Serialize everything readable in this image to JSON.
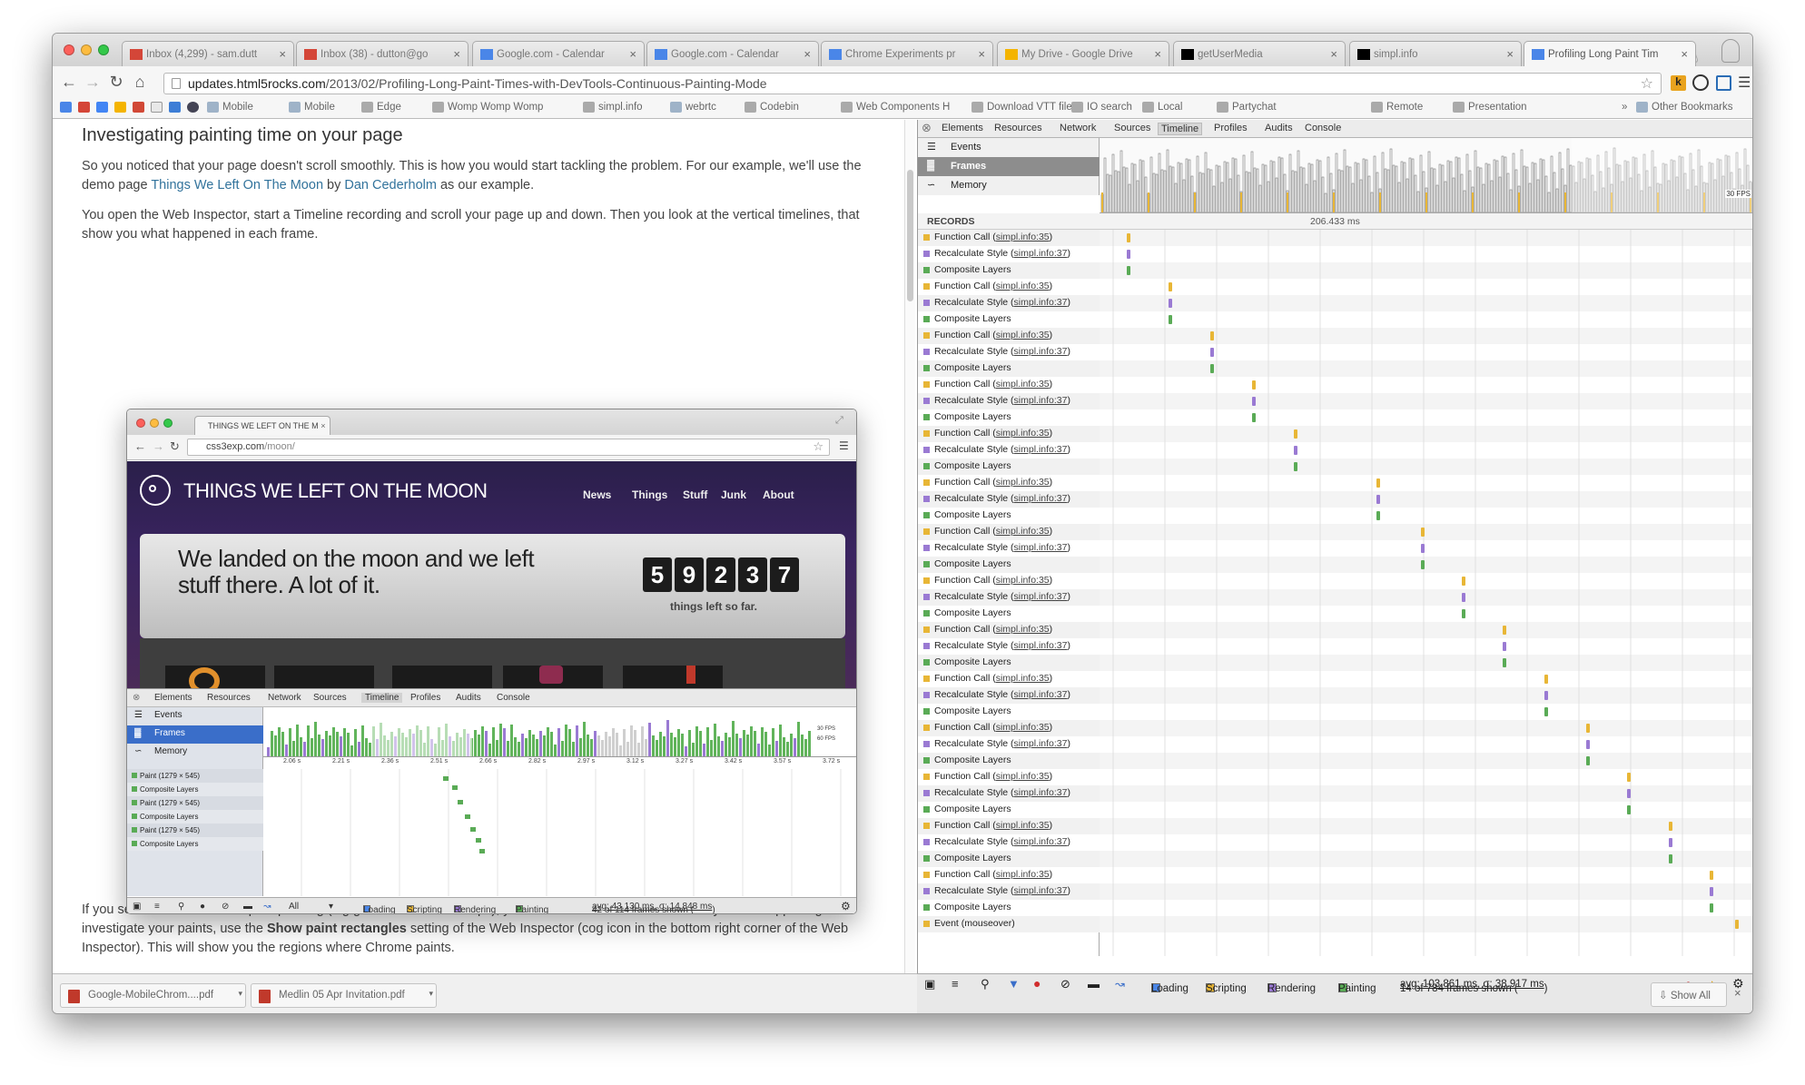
{
  "tabs": [
    {
      "label": "Inbox (4,299) - sam.dutt",
      "icon": "gmail-icon",
      "color": "#d44638"
    },
    {
      "label": "Inbox (38) - dutton@go",
      "icon": "gmail-icon",
      "color": "#d44638"
    },
    {
      "label": "Google.com - Calendar",
      "icon": "calendar-icon",
      "color": "#4a86e8"
    },
    {
      "label": "Google.com - Calendar",
      "icon": "calendar-icon",
      "color": "#4a86e8"
    },
    {
      "label": "Chrome Experiments pr",
      "icon": "page-icon",
      "color": "#4a86e8"
    },
    {
      "label": "My Drive - Google Drive",
      "icon": "drive-icon",
      "color": "#f4b400"
    },
    {
      "label": "getUserMedia",
      "icon": "simpl-icon",
      "color": "#000000"
    },
    {
      "label": "simpl.info",
      "icon": "simpl-icon",
      "color": "#000000"
    },
    {
      "label": "Profiling Long Paint Tim",
      "icon": "html5-icon",
      "color": "#4a86e8"
    }
  ],
  "omnibox": {
    "host": "updates.html5rocks.com",
    "path": "/2013/02/Profiling-Long-Paint-Times-with-DevTools-Continuous-Painting-Mode"
  },
  "bookmarks": [
    "Mobile",
    "Mobile",
    "Edge",
    "Womp Womp Womp",
    "simpl.info",
    "webrtc",
    "Codebin",
    "Web Components H",
    "Download VTT files",
    "IO search",
    "Local",
    "Partychat",
    "Remote",
    "Presentation",
    "Other Bookmarks"
  ],
  "article": {
    "heading": "Investigating painting time on your page",
    "p1_a": "So you noticed that your page doesn't scroll smoothly. This is how you would start tackling the problem. For our example, we'll use the demo page ",
    "p1_link1": "Things We Left On The Moon",
    "p1_b": " by ",
    "p1_link2": "Dan Cederholm",
    "p1_c": " as our example.",
    "p2": "You open the Web Inspector, start a Timeline recording and scroll your page up and down. Then you look at the vertical timelines, that show you what happened in each frame.",
    "p3_a": "If you see that most time is spent painting (big green bars above 60fps), you need to take a closer look at why this is happening. To investigate your paints, use the ",
    "p3_bold": "Show paint rectangles",
    "p3_b": " setting of the Web Inspector (cog icon in the bottom right corner of the Web Inspector). This will show you the regions where Chrome paints."
  },
  "screenshot": {
    "tab": "THINGS WE LEFT ON THE M",
    "url_host": "css3exp.com",
    "url_path": "/moon/",
    "site_title": "THINGS WE LEFT ON THE MOON",
    "nav": [
      "News",
      "Things",
      "Stuff",
      "Junk",
      "About"
    ],
    "hero": "We landed on the moon and we left stuff there. A lot of it.",
    "counter": [
      "5",
      "9",
      "2",
      "3",
      "7"
    ],
    "counter_caption": "things left so far.",
    "devtabs": [
      "Elements",
      "Resources",
      "Network",
      "Sources",
      "Timeline",
      "Profiles",
      "Audits",
      "Console"
    ],
    "side": [
      "Events",
      "Frames",
      "Memory"
    ],
    "times": [
      "2.06 s",
      "2.21 s",
      "2.36 s",
      "2.51 s",
      "2.66 s",
      "2.82 s",
      "2.97 s",
      "3.12 s",
      "3.27 s",
      "3.42 s",
      "3.57 s",
      "3.72 s"
    ],
    "records": [
      "Paint (1279 × 545)",
      "Composite Layers",
      "Paint (1279 × 545)",
      "Composite Layers",
      "Paint (1279 × 545)",
      "Composite Layers"
    ],
    "fps30": "30 FPS",
    "fps60": "60 FPS",
    "filter": "All",
    "checks": [
      "Loading",
      "Scripting",
      "Rendering",
      "Painting"
    ],
    "status_a": "42 of 114 frames shown (",
    "status_u": "avg: 43.130 ms, σ: 14.848 ms",
    "status_b": ")"
  },
  "devtools": {
    "tabs": [
      "Elements",
      "Resources",
      "Network",
      "Sources",
      "Timeline",
      "Profiles",
      "Audits",
      "Console"
    ],
    "side": [
      "Events",
      "Frames",
      "Memory"
    ],
    "fps": "30 FPS",
    "records_label": "RECORDS",
    "time_marker": "206.433 ms",
    "rows": [
      {
        "t": "Function Call",
        "l": "simpl.info:35",
        "c": "#e8b636"
      },
      {
        "t": "Recalculate Style",
        "l": "simpl.info:37",
        "c": "#9a7ad3"
      },
      {
        "t": "Composite Layers",
        "l": "",
        "c": "#5aab56"
      },
      {
        "t": "Function Call",
        "l": "simpl.info:35",
        "c": "#e8b636"
      },
      {
        "t": "Recalculate Style",
        "l": "simpl.info:37",
        "c": "#9a7ad3"
      },
      {
        "t": "Composite Layers",
        "l": "",
        "c": "#5aab56"
      },
      {
        "t": "Function Call",
        "l": "simpl.info:35",
        "c": "#e8b636"
      },
      {
        "t": "Recalculate Style",
        "l": "simpl.info:37",
        "c": "#9a7ad3"
      },
      {
        "t": "Composite Layers",
        "l": "",
        "c": "#5aab56"
      },
      {
        "t": "Function Call",
        "l": "simpl.info:35",
        "c": "#e8b636"
      },
      {
        "t": "Recalculate Style",
        "l": "simpl.info:37",
        "c": "#9a7ad3"
      },
      {
        "t": "Composite Layers",
        "l": "",
        "c": "#5aab56"
      },
      {
        "t": "Function Call",
        "l": "simpl.info:35",
        "c": "#e8b636"
      },
      {
        "t": "Recalculate Style",
        "l": "simpl.info:37",
        "c": "#9a7ad3"
      },
      {
        "t": "Composite Layers",
        "l": "",
        "c": "#5aab56"
      },
      {
        "t": "Function Call",
        "l": "simpl.info:35",
        "c": "#e8b636"
      },
      {
        "t": "Recalculate Style",
        "l": "simpl.info:37",
        "c": "#9a7ad3"
      },
      {
        "t": "Composite Layers",
        "l": "",
        "c": "#5aab56"
      },
      {
        "t": "Function Call",
        "l": "simpl.info:35",
        "c": "#e8b636"
      },
      {
        "t": "Recalculate Style",
        "l": "simpl.info:37",
        "c": "#9a7ad3"
      },
      {
        "t": "Composite Layers",
        "l": "",
        "c": "#5aab56"
      },
      {
        "t": "Function Call",
        "l": "simpl.info:35",
        "c": "#e8b636"
      },
      {
        "t": "Recalculate Style",
        "l": "simpl.info:37",
        "c": "#9a7ad3"
      },
      {
        "t": "Composite Layers",
        "l": "",
        "c": "#5aab56"
      },
      {
        "t": "Function Call",
        "l": "simpl.info:35",
        "c": "#e8b636"
      },
      {
        "t": "Recalculate Style",
        "l": "simpl.info:37",
        "c": "#9a7ad3"
      },
      {
        "t": "Composite Layers",
        "l": "",
        "c": "#5aab56"
      },
      {
        "t": "Function Call",
        "l": "simpl.info:35",
        "c": "#e8b636"
      },
      {
        "t": "Recalculate Style",
        "l": "simpl.info:37",
        "c": "#9a7ad3"
      },
      {
        "t": "Composite Layers",
        "l": "",
        "c": "#5aab56"
      },
      {
        "t": "Function Call",
        "l": "simpl.info:35",
        "c": "#e8b636"
      },
      {
        "t": "Recalculate Style",
        "l": "simpl.info:37",
        "c": "#9a7ad3"
      },
      {
        "t": "Composite Layers",
        "l": "",
        "c": "#5aab56"
      },
      {
        "t": "Function Call",
        "l": "simpl.info:35",
        "c": "#e8b636"
      },
      {
        "t": "Recalculate Style",
        "l": "simpl.info:37",
        "c": "#9a7ad3"
      },
      {
        "t": "Composite Layers",
        "l": "",
        "c": "#5aab56"
      },
      {
        "t": "Function Call",
        "l": "simpl.info:35",
        "c": "#e8b636"
      },
      {
        "t": "Recalculate Style",
        "l": "simpl.info:37",
        "c": "#9a7ad3"
      },
      {
        "t": "Composite Layers",
        "l": "",
        "c": "#5aab56"
      },
      {
        "t": "Function Call",
        "l": "simpl.info:35",
        "c": "#e8b636"
      },
      {
        "t": "Recalculate Style",
        "l": "simpl.info:37",
        "c": "#9a7ad3"
      },
      {
        "t": "Composite Layers",
        "l": "",
        "c": "#5aab56"
      },
      {
        "t": "Event (mouseover)",
        "l": "",
        "c": "#e8b636"
      }
    ],
    "checks": [
      "Loading",
      "Scripting",
      "Rendering",
      "Painting"
    ],
    "status_a": "14 of 784 frames shown (",
    "status_u": "avg: 103.861 ms, σ: 38.917 ms",
    "status_b": ")",
    "errors": "1",
    "warnings": "1"
  },
  "downloads": [
    "Google-MobileChrom....pdf",
    "Medlin 05 Apr Invitation.pdf"
  ],
  "show_all": "Show All"
}
